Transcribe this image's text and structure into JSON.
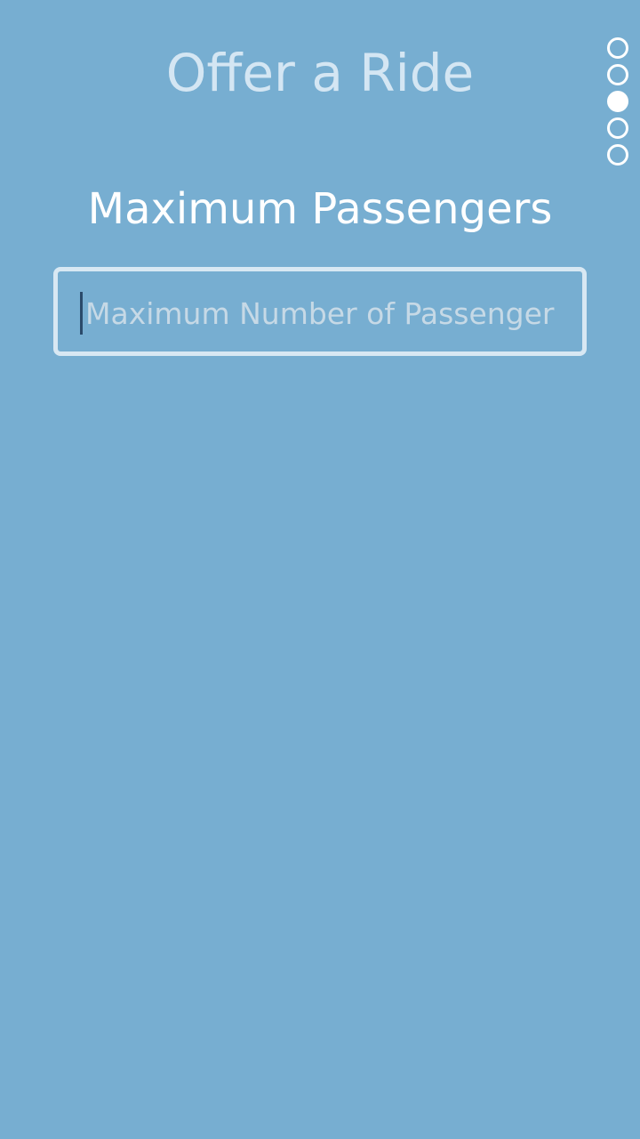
{
  "header": {
    "title": "Offer a Ride"
  },
  "steps": {
    "total": 5,
    "current": 3
  },
  "form": {
    "heading": "Maximum Passengers",
    "max_passengers_input": {
      "value": "",
      "placeholder": "Maximum Number of Passenger"
    }
  },
  "colors": {
    "background": "#77AED1",
    "title": "#D4E6F3",
    "heading": "#FFFFFF",
    "input_border": "#D8E8F3",
    "placeholder": "#C6D9E6",
    "step_dot": "#FFFFFF"
  }
}
